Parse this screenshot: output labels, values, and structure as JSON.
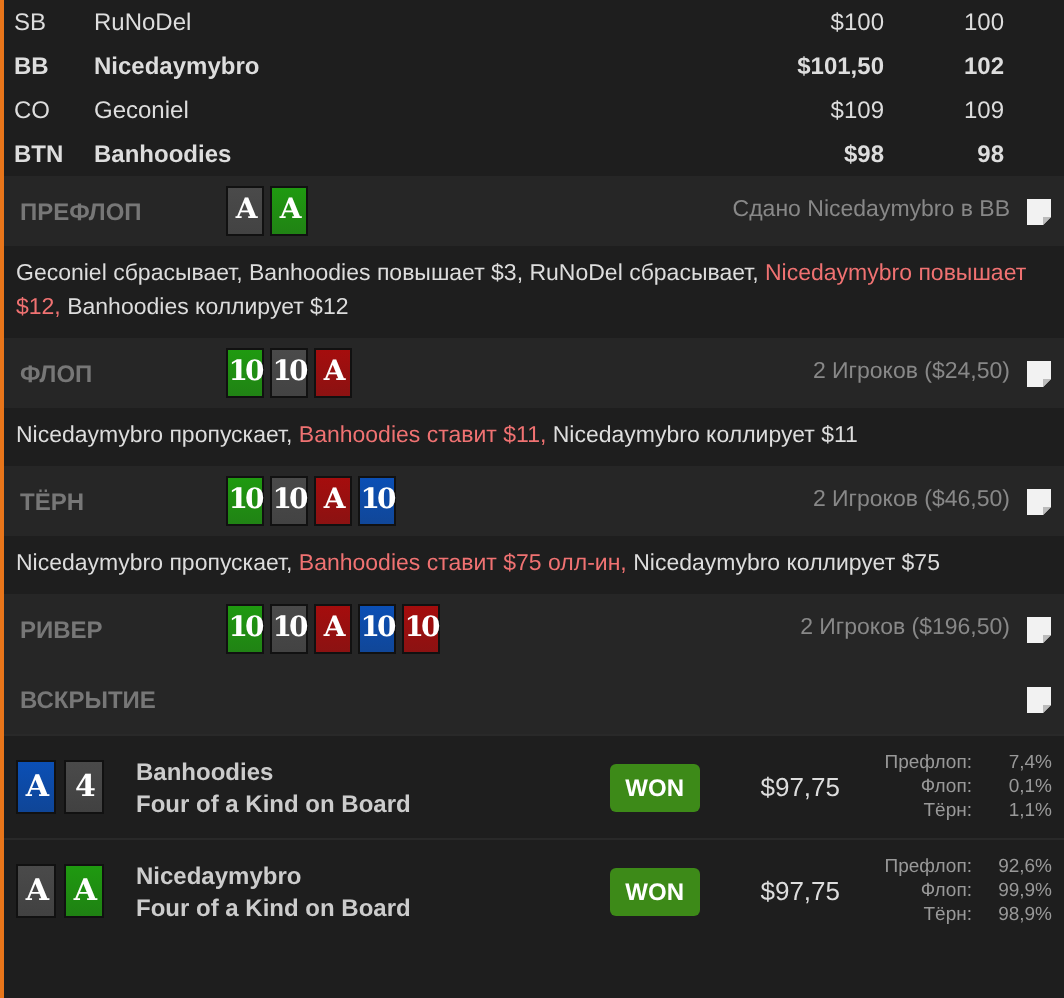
{
  "players": [
    {
      "position": "SB",
      "name": "RuNoDel",
      "stack": "$100",
      "bb": "100",
      "hero": false
    },
    {
      "position": "BB",
      "name": "Nicedaymybro",
      "stack": "$101,50",
      "bb": "102",
      "hero": true
    },
    {
      "position": "CO",
      "name": "Geconiel",
      "stack": "$109",
      "bb": "109",
      "hero": false
    },
    {
      "position": "BTN",
      "name": "Banhoodies",
      "stack": "$98",
      "bb": "98",
      "hero": true
    }
  ],
  "streets": [
    {
      "title": "ПРЕФЛОП",
      "cards": [
        {
          "rank": "A",
          "color": "#4a4a4a"
        },
        {
          "rank": "A",
          "color": "#1f9a10"
        }
      ],
      "info": "Сдано Nicedaymybro в BB",
      "actions": [
        {
          "text": "Geconiel сбрасывает, Banhoodies повышает $3, RuNoDel сбрасывает,",
          "highlight": false
        },
        {
          "text": "Nicedaymybro повышает $12,",
          "highlight": true
        },
        {
          "text": "Banhoodies коллирует $12",
          "highlight": false
        }
      ]
    },
    {
      "title": "ФЛОП",
      "cards": [
        {
          "rank": "10",
          "color": "#1f9a10"
        },
        {
          "rank": "10",
          "color": "#4a4a4a"
        },
        {
          "rank": "A",
          "color": "#a50d0d"
        }
      ],
      "info": "2 Игроков ($24,50)",
      "actions": [
        {
          "text": "Nicedaymybro пропускает,",
          "highlight": false
        },
        {
          "text": "Banhoodies ставит $11,",
          "highlight": true
        },
        {
          "text": "Nicedaymybro коллирует $11",
          "highlight": false
        }
      ]
    },
    {
      "title": "ТЁРН",
      "cards": [
        {
          "rank": "10",
          "color": "#1f9a10"
        },
        {
          "rank": "10",
          "color": "#4a4a4a"
        },
        {
          "rank": "A",
          "color": "#a50d0d"
        },
        {
          "rank": "10",
          "color": "#0b4fb5"
        }
      ],
      "info": "2 Игроков ($46,50)",
      "actions": [
        {
          "text": "Nicedaymybro пропускает,",
          "highlight": false
        },
        {
          "text": "Banhoodies ставит $75 олл-ин,",
          "highlight": true
        },
        {
          "text": "Nicedaymybro коллирует $75",
          "highlight": false
        }
      ]
    },
    {
      "title": "РИВЕР",
      "cards": [
        {
          "rank": "10",
          "color": "#1f9a10"
        },
        {
          "rank": "10",
          "color": "#4a4a4a"
        },
        {
          "rank": "A",
          "color": "#a50d0d"
        },
        {
          "rank": "10",
          "color": "#0b4fb5"
        },
        {
          "rank": "10",
          "color": "#a50d0d"
        }
      ],
      "info": "2 Игроков ($196,50)"
    },
    {
      "title": "ВСКРЫТИЕ"
    }
  ],
  "showdown": [
    {
      "cards": [
        {
          "rank": "A",
          "color": "#0b4fb5"
        },
        {
          "rank": "4",
          "color": "#4a4a4a"
        }
      ],
      "name": "Banhoodies",
      "hand": "Four of a Kind on Board",
      "result": "WON",
      "amount": "$97,75",
      "equity": [
        {
          "label": "Префлоп:",
          "value": "7,4%"
        },
        {
          "label": "Флоп:",
          "value": "0,1%"
        },
        {
          "label": "Тёрн:",
          "value": "1,1%"
        }
      ]
    },
    {
      "cards": [
        {
          "rank": "A",
          "color": "#4a4a4a"
        },
        {
          "rank": "A",
          "color": "#1f9a10"
        }
      ],
      "name": "Nicedaymybro",
      "hand": "Four of a Kind on Board",
      "result": "WON",
      "amount": "$97,75",
      "equity": [
        {
          "label": "Префлоп:",
          "value": "92,6%"
        },
        {
          "label": "Флоп:",
          "value": "99,9%"
        },
        {
          "label": "Тёрн:",
          "value": "98,9%"
        }
      ]
    }
  ]
}
